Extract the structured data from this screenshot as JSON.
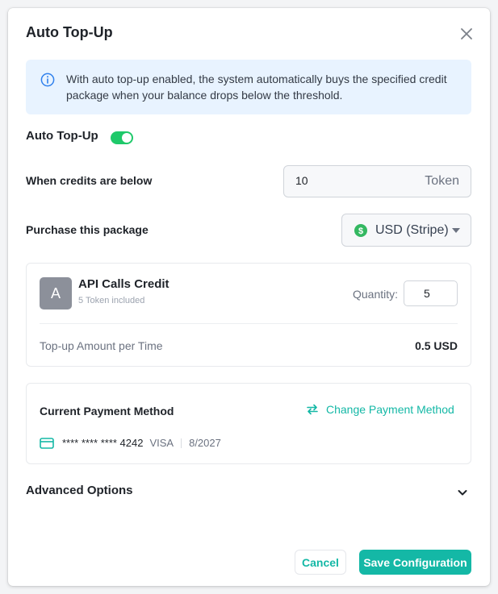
{
  "dialog": {
    "title": "Auto Top-Up",
    "info_text": "With auto top-up enabled, the system automatically buys the specified credit package when your balance drops below the threshold."
  },
  "auto_topup": {
    "label": "Auto Top-Up",
    "enabled": true,
    "toggle_color": "#1fc96a"
  },
  "threshold": {
    "label": "When credits are below",
    "value": "10",
    "unit": "Token"
  },
  "package_select": {
    "label": "Purchase this package",
    "currency": "USD (Stripe)"
  },
  "package": {
    "avatar_letter": "A",
    "name": "API Calls Credit",
    "included": "5 Token included",
    "quantity_label": "Quantity:",
    "quantity": "5",
    "amount_label": "Top-up Amount per Time",
    "amount_value": "0.5 USD"
  },
  "payment": {
    "title": "Current Payment Method",
    "change_label": "Change Payment Method",
    "card_number": "**** **** **** 4242",
    "card_brand": "VISA",
    "card_expiry": "8/2027"
  },
  "advanced": {
    "label": "Advanced Options"
  },
  "footer": {
    "cancel_label": "Cancel",
    "save_label": "Save Configuration"
  },
  "colors": {
    "accent": "#14b8a6",
    "info_bg": "#e8f3ff",
    "info_icon": "#2f80ed"
  }
}
